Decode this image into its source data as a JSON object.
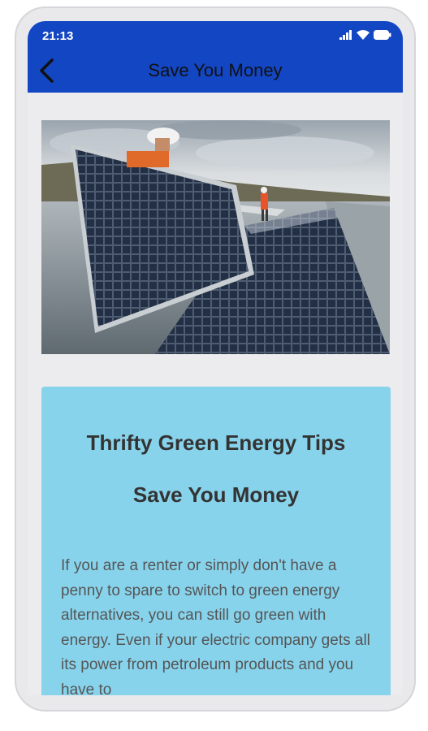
{
  "status": {
    "time": "21:13"
  },
  "appbar": {
    "title": "Save You Money"
  },
  "article": {
    "heading": "Thrifty Green Energy Tips",
    "subheading": "Save You Money",
    "body": "If you are a renter or simply don't have a penny to spare to switch to green energy alternatives, you can still go green with energy. Even if your electric company gets all its power from petroleum products and you have to"
  },
  "colors": {
    "appbar": "#1346c2",
    "card": "#88d3ec",
    "background": "#ececee"
  },
  "icons": {
    "back": "back-arrow-icon",
    "signal": "signal-icon",
    "wifi": "wifi-icon",
    "battery": "battery-icon"
  }
}
